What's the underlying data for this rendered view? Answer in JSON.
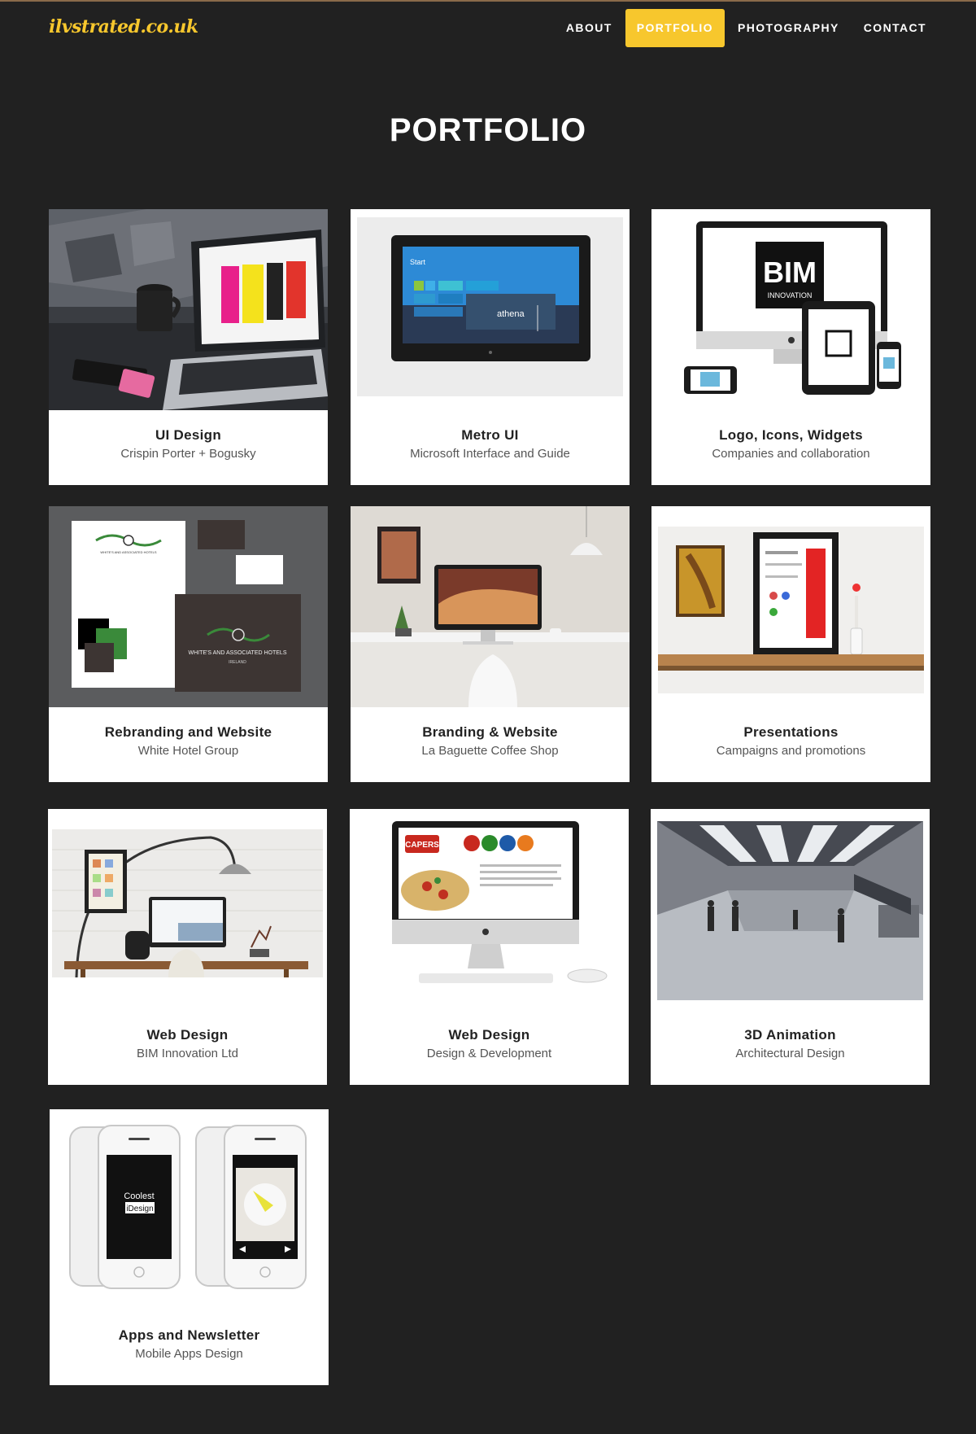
{
  "site": {
    "logo": "ilvstrated.co.uk"
  },
  "nav": {
    "items": [
      {
        "label": "ABOUT",
        "active": false
      },
      {
        "label": "PORTFOLIO",
        "active": true
      },
      {
        "label": "PHOTOGRAPHY",
        "active": false
      },
      {
        "label": "CONTACT",
        "active": false
      }
    ]
  },
  "page": {
    "title": "PORTFOLIO"
  },
  "colors": {
    "background": "#212121",
    "accent": "#f7c72d",
    "card": "#ffffff"
  },
  "portfolio": {
    "items": [
      {
        "title": "UI Design",
        "subtitle": "Crispin Porter + Bogusky",
        "image": "laptop-on-desk-image"
      },
      {
        "title": "Metro UI",
        "subtitle": "Microsoft Interface and Guide",
        "image": "tablet-metro-ui-image",
        "screen": {
          "start": "Start",
          "tile": "athena"
        }
      },
      {
        "title": "Logo, Icons, Widgets",
        "subtitle": "Companies and collaboration",
        "image": "bim-devices-image",
        "logo_text": "BIM",
        "logo_sub": "INNOVATION"
      },
      {
        "title": "Rebranding and Website",
        "subtitle": "White Hotel Group",
        "image": "hotel-stationery-image",
        "brand": "WHITE'S AND ASSOCIATED HOTELS",
        "brand_sub": "IRELAND"
      },
      {
        "title": "Branding & Website",
        "subtitle": "La Baguette Coffee Shop",
        "image": "imac-workspace-image"
      },
      {
        "title": "Presentations",
        "subtitle": "Campaigns and promotions",
        "image": "framed-posters-image"
      },
      {
        "title": "Web Design",
        "subtitle": "BIM Innovation Ltd",
        "image": "arc-lamp-desk-image"
      },
      {
        "title": "Web Design",
        "subtitle": "Design & Development",
        "image": "capers-imac-image",
        "brand": "CAPERS"
      },
      {
        "title": "3D Animation",
        "subtitle": "Architectural Design",
        "image": "station-render-image"
      },
      {
        "title": "Apps and Newsletter",
        "subtitle": "Mobile Apps Design",
        "image": "iphones-app-image",
        "app_name": "Coolest",
        "app_name2": "iDesign"
      }
    ]
  }
}
